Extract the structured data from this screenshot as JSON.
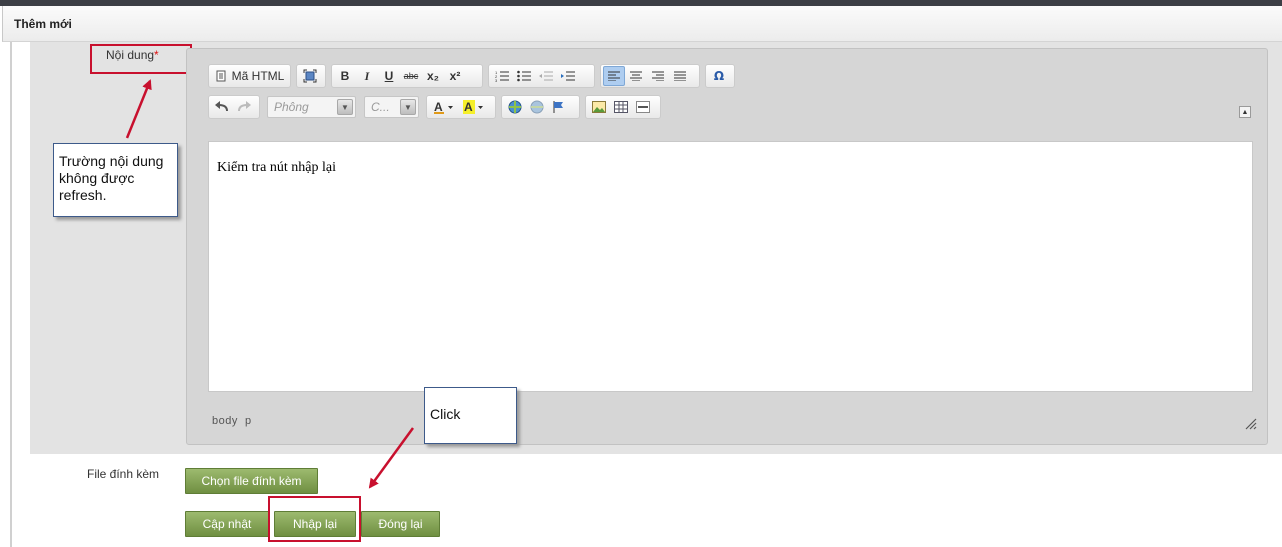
{
  "panel": {
    "title": "Thêm mới"
  },
  "form": {
    "content_label": "Nội dung",
    "required_mark": "*",
    "file_label": "File đính kèm",
    "choose_file_button": "Chọn file đính kèm",
    "buttons": {
      "update": "Cập nhật",
      "reset": "Nhập lại",
      "close": "Đóng lại"
    }
  },
  "editor": {
    "toolbar": {
      "source_label": "Mã HTML",
      "bold": "B",
      "italic": "I",
      "underline": "U",
      "strike": "abc",
      "subscript": "x₂",
      "superscript": "x²",
      "special_char": "Ω",
      "font_combo_placeholder": "Phông",
      "size_combo_placeholder": "C..."
    },
    "content": "Kiểm tra nút nhập lại",
    "path": "body  p"
  },
  "callouts": {
    "content_note": "Trường nội dung không được  refresh.",
    "click_note": "Click"
  },
  "colors": {
    "accent_red": "#c8102e",
    "button_green": "#7a9a4a",
    "callout_border": "#3d5a8a"
  }
}
